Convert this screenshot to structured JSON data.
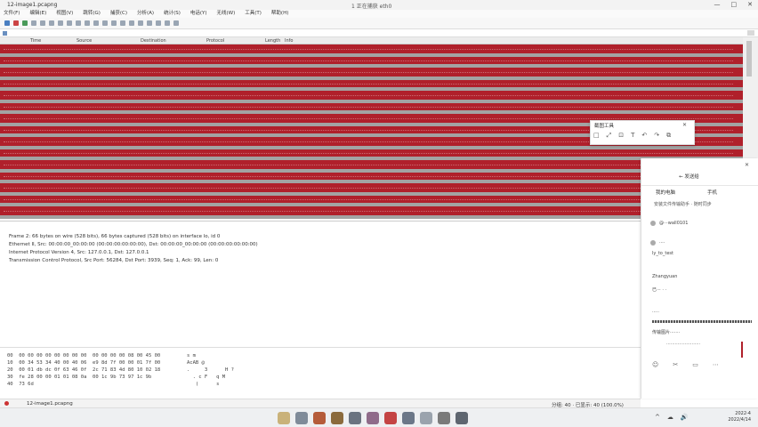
{
  "window": {
    "app_title": "12-image1.pcapng",
    "center_title": "1 正在捕获 eth0",
    "controls": [
      "—",
      "□",
      "✕"
    ]
  },
  "menu": [
    "文件(F)",
    "编辑(E)",
    "视图(V)",
    "跳转(G)",
    "捕获(C)",
    "分析(A)",
    "统计(S)",
    "电话(Y)",
    "无线(W)",
    "工具(T)",
    "帮助(H)"
  ],
  "columns": [
    "Time",
    "Source",
    "Destination",
    "Protocol",
    "Length",
    "Info"
  ],
  "details": [
    "Frame 2: 66 bytes on wire (528 bits), 66 bytes captured (528 bits) on interface lo, id 0",
    "Ethernet II, Src: 00:00:00_00:00:00 (00:00:00:00:00:00), Dst: 00:00:00_00:00:00 (00:00:00:00:00:00)",
    "Internet Protocol Version 4, Src: 127.0.0.1, Dst: 127.0.0.1",
    "Transmission Control Protocol, Src Port: 56284, Dst Port: 3939, Seq: 1, Ack: 99, Len: 0"
  ],
  "bytes": {
    "offsets": [
      "00",
      "10",
      "20",
      "30",
      "40"
    ],
    "hex": [
      "00 00 00 00 00 00 00 00  00 00 00 00 08 00 45 00",
      "00 34 53 34 40 00 40 06  e9 8d 7f 00 00 01 7f 00",
      "00 01 db dc 0f 63 46 0f  2c 71 83 4d 80 10 02 18",
      "fe 28 00 00 01 01 08 0a  00 1c 9b 73 97 1c 9b",
      "73 6d"
    ],
    "ascii": [
      "AcAB @",
      ".     3      H ?",
      "  . c F   q M",
      "   (      s",
      "s m"
    ]
  },
  "status": {
    "file": "12-image1.pcapng",
    "stats": "分组: 40 · 已显示: 40 (100.0%)"
  },
  "snap_tool": {
    "title": "截图工具",
    "close": "✕",
    "tools": [
      "□",
      "⤢",
      "⊡",
      "T",
      "↶",
      "↷",
      "⧉"
    ]
  },
  "chat": {
    "title": "← 发送给",
    "close": "✕",
    "tab_1": "我的电脑",
    "tab_2": "手机",
    "desc": "安装文件传输助手 · 随时同步",
    "items": [
      "@···wall0101",
      "····",
      "ly_to_test",
      "Zhangyuan",
      "已···  ·   ·",
      "·····",
      "传输图片·······"
    ],
    "link": "························",
    "icons": [
      "☺",
      "✂",
      "▭",
      "⋯"
    ]
  },
  "taskbar": {
    "tray": [
      "^",
      "☁",
      "🔊"
    ],
    "time": "2022-4",
    "date": "2022/4/14"
  },
  "colors": {
    "packet_red": "#b0202b",
    "packet_grey": "#a3a3a3",
    "accent": "#c44444"
  }
}
